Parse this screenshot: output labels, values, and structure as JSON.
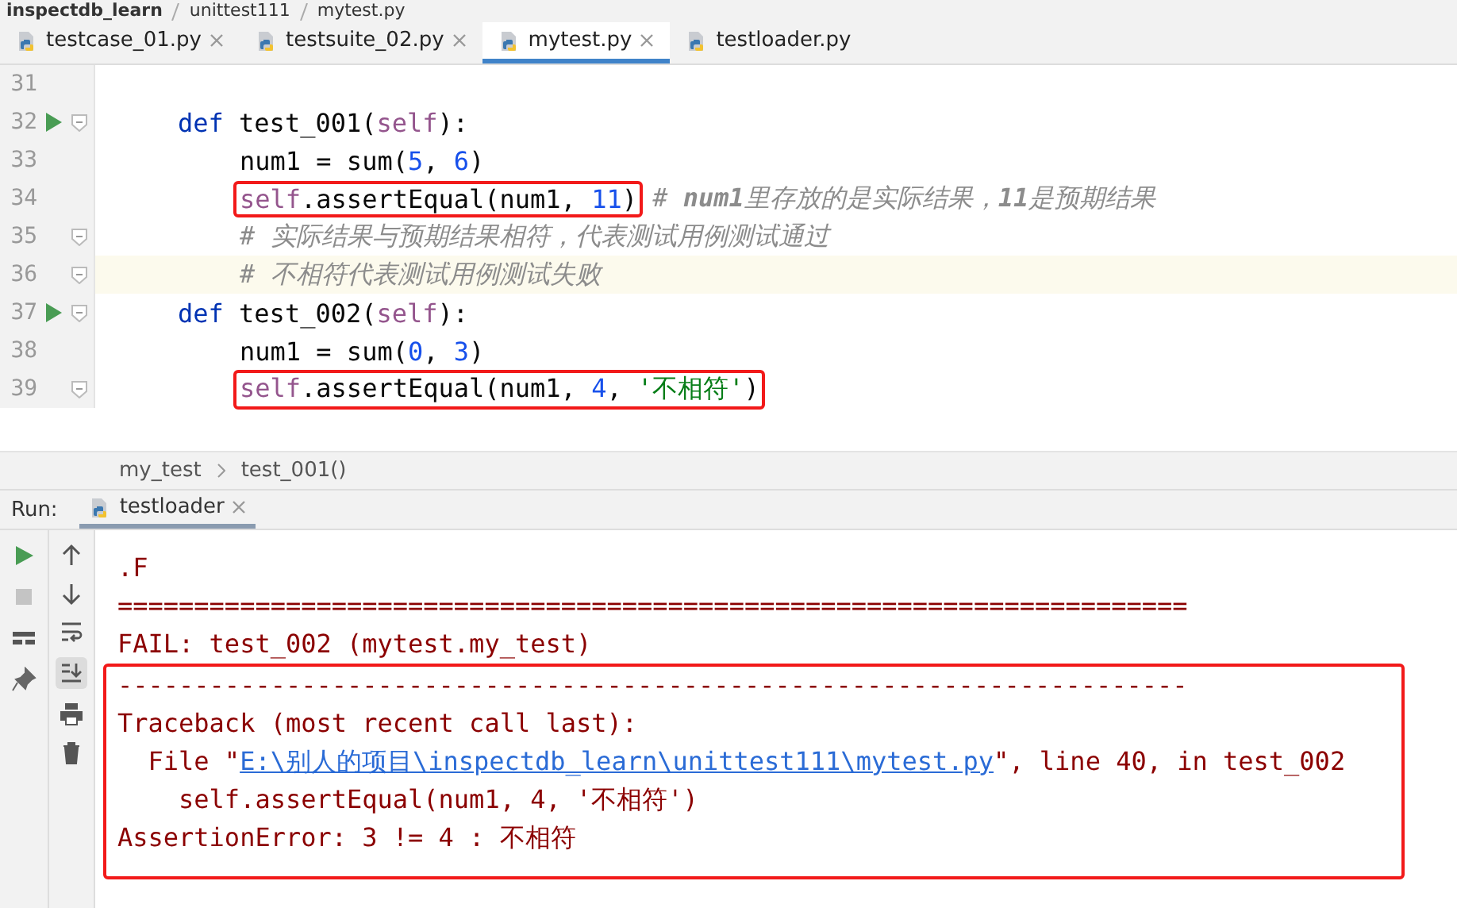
{
  "path_bar": {
    "items": [
      "inspectdb_learn",
      "unittest111",
      "mytest.py"
    ]
  },
  "tabs": [
    {
      "label": "testcase_01.py",
      "selected": false,
      "closable": true
    },
    {
      "label": "testsuite_02.py",
      "selected": false,
      "closable": true
    },
    {
      "label": "mytest.py",
      "selected": true,
      "closable": true
    },
    {
      "label": "testloader.py",
      "selected": false,
      "closable": false
    }
  ],
  "editor": {
    "lines": [
      {
        "number": "31",
        "runnable": false,
        "fold": false,
        "current": false
      },
      {
        "number": "32",
        "runnable": true,
        "fold": true,
        "current": false,
        "body": false,
        "segments": [
          {
            "boxed": false,
            "tokens": [
              {
                "kind": "keyword",
                "text": "def"
              },
              {
                "kind": "plain",
                "text": " test_001("
              },
              {
                "kind": "self",
                "text": "self"
              },
              {
                "kind": "plain",
                "text": "):"
              }
            ]
          }
        ]
      },
      {
        "number": "33",
        "runnable": false,
        "fold": false,
        "current": false,
        "body": true,
        "segments": [
          {
            "boxed": false,
            "tokens": [
              {
                "kind": "plain",
                "text": "num1 = sum("
              },
              {
                "kind": "number",
                "text": "5"
              },
              {
                "kind": "plain",
                "text": ", "
              },
              {
                "kind": "number",
                "text": "6"
              },
              {
                "kind": "plain",
                "text": ")"
              }
            ]
          }
        ]
      },
      {
        "number": "34",
        "runnable": false,
        "fold": false,
        "current": false,
        "body": true,
        "segments": [
          {
            "boxed": true,
            "tokens": [
              {
                "kind": "self",
                "text": "self"
              },
              {
                "kind": "plain",
                "text": ".assertEqual(num1, "
              },
              {
                "kind": "number",
                "text": "11"
              },
              {
                "kind": "plain",
                "text": ")"
              }
            ]
          },
          {
            "boxed": false,
            "tokens": [
              {
                "kind": "comment",
                "text": " # **num1**里存放的是实际结果，**11**是预期结果"
              }
            ]
          }
        ]
      },
      {
        "number": "35",
        "runnable": false,
        "fold": true,
        "current": false,
        "body": true,
        "segments": [
          {
            "boxed": false,
            "tokens": [
              {
                "kind": "comment",
                "text": "# 实际结果与预期结果相符，代表测试用例测试通过"
              }
            ]
          }
        ]
      },
      {
        "number": "36",
        "runnable": false,
        "fold": true,
        "current": true,
        "body": true,
        "segments": [
          {
            "boxed": false,
            "tokens": [
              {
                "kind": "comment",
                "text": "# 不相符代表测试用例测试失败"
              }
            ]
          }
        ]
      },
      {
        "number": "37",
        "runnable": true,
        "fold": true,
        "current": false,
        "body": false,
        "segments": [
          {
            "boxed": false,
            "tokens": [
              {
                "kind": "keyword",
                "text": "def"
              },
              {
                "kind": "plain",
                "text": " test_002("
              },
              {
                "kind": "self",
                "text": "self"
              },
              {
                "kind": "plain",
                "text": "):"
              }
            ]
          }
        ]
      },
      {
        "number": "38",
        "runnable": false,
        "fold": false,
        "current": false,
        "body": true,
        "segments": [
          {
            "boxed": false,
            "tokens": [
              {
                "kind": "plain",
                "text": "num1 = sum("
              },
              {
                "kind": "number",
                "text": "0"
              },
              {
                "kind": "plain",
                "text": ", "
              },
              {
                "kind": "number",
                "text": "3"
              },
              {
                "kind": "plain",
                "text": ")"
              }
            ]
          }
        ]
      },
      {
        "number": "39",
        "runnable": false,
        "fold": true,
        "current": false,
        "body": true,
        "segments": [
          {
            "boxed": true,
            "tokens": [
              {
                "kind": "self",
                "text": "self"
              },
              {
                "kind": "plain",
                "text": ".assertEqual(num1, "
              },
              {
                "kind": "number",
                "text": "4"
              },
              {
                "kind": "plain",
                "text": ", "
              },
              {
                "kind": "string",
                "text": "'不相符'"
              },
              {
                "kind": "plain",
                "text": ")"
              }
            ]
          }
        ]
      }
    ]
  },
  "breadcrumb": [
    "my_test",
    "test_001()"
  ],
  "run_panel": {
    "label": "Run:",
    "tab": {
      "label": "testloader",
      "selected": true
    },
    "lines": [
      {
        "boxed": false,
        "tokens": [
          {
            "kind": "error",
            "text": ".F"
          }
        ]
      },
      {
        "boxed": false,
        "tokens": [
          {
            "kind": "error",
            "text": "======================================================================"
          }
        ]
      },
      {
        "boxed": false,
        "tokens": [
          {
            "kind": "error",
            "text": "FAIL: test_002 (mytest.my_test)"
          }
        ]
      },
      {
        "boxed": true,
        "tokens": [
          {
            "kind": "error",
            "text": "----------------------------------------------------------------------"
          }
        ]
      },
      {
        "boxed": true,
        "tokens": [
          {
            "kind": "error",
            "text": "Traceback (most recent call last):"
          }
        ]
      },
      {
        "boxed": true,
        "tokens": [
          {
            "kind": "error",
            "text": "  File \""
          },
          {
            "kind": "link",
            "text": "E:\\别人的项目\\inspectdb_learn\\unittest111\\mytest.py"
          },
          {
            "kind": "error",
            "text": "\", line 40, in test_002"
          }
        ]
      },
      {
        "boxed": true,
        "tokens": [
          {
            "kind": "error",
            "text": "    self.assertEqual(num1, 4, '不相符')"
          }
        ]
      },
      {
        "boxed": true,
        "tokens": [
          {
            "kind": "error",
            "text": "AssertionError: 3 != 4 : 不相符"
          }
        ]
      }
    ]
  }
}
